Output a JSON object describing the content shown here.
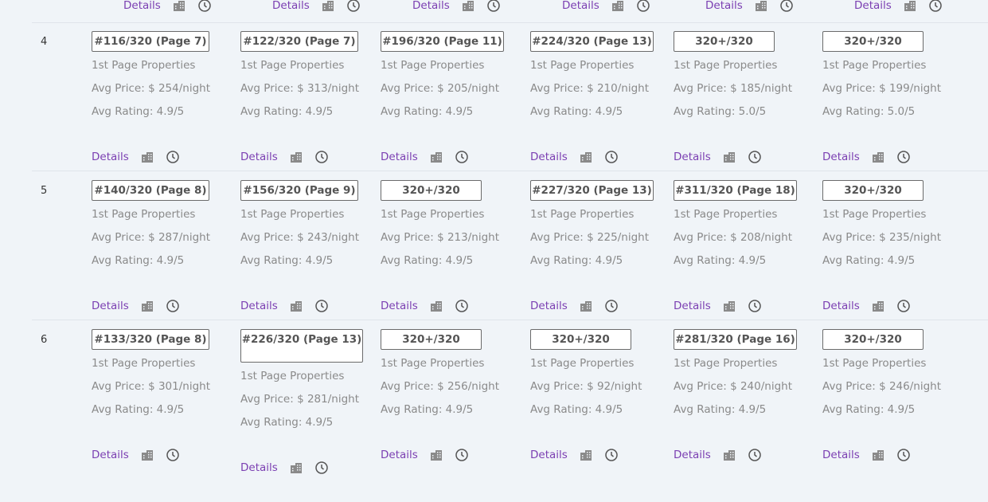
{
  "labels": {
    "details": "Details",
    "first_page": "1st Page Properties"
  },
  "colors": {
    "background": "#f0f4f8",
    "link": "#7b3fb2",
    "muted_text": "#8a8a8a",
    "icon": "#8a8a8a"
  },
  "icons": [
    "building-icon",
    "history-clock-icon"
  ],
  "rows": [
    {
      "rank": "4",
      "cells": [
        {
          "badge": "#116/320 (Page 7)",
          "price": "Avg Price: $ 254/night",
          "rating": "Avg Rating: 4.9/5"
        },
        {
          "badge": "#122/320 (Page 7)",
          "price": "Avg Price: $ 313/night",
          "rating": "Avg Rating: 4.9/5"
        },
        {
          "badge": "#196/320 (Page 11)",
          "price": "Avg Price: $ 205/night",
          "rating": "Avg Rating: 4.9/5"
        },
        {
          "badge": "#224/320 (Page 13)",
          "price": "Avg Price: $ 210/night",
          "rating": "Avg Rating: 4.9/5"
        },
        {
          "badge": "320+/320",
          "price": "Avg Price: $ 185/night",
          "rating": "Avg Rating: 5.0/5"
        },
        {
          "badge": "320+/320",
          "price": "Avg Price: $ 199/night",
          "rating": "Avg Rating: 5.0/5"
        }
      ]
    },
    {
      "rank": "5",
      "cells": [
        {
          "badge": "#140/320 (Page 8)",
          "price": "Avg Price: $ 287/night",
          "rating": "Avg Rating: 4.9/5"
        },
        {
          "badge": "#156/320 (Page 9)",
          "price": "Avg Price: $ 243/night",
          "rating": "Avg Rating: 4.9/5"
        },
        {
          "badge": "320+/320",
          "price": "Avg Price: $ 213/night",
          "rating": "Avg Rating: 4.9/5"
        },
        {
          "badge": "#227/320 (Page 13)",
          "price": "Avg Price: $ 225/night",
          "rating": "Avg Rating: 4.9/5"
        },
        {
          "badge": "#311/320 (Page 18)",
          "price": "Avg Price: $ 208/night",
          "rating": "Avg Rating: 4.9/5"
        },
        {
          "badge": "320+/320",
          "price": "Avg Price: $ 235/night",
          "rating": "Avg Rating: 4.9/5"
        }
      ]
    },
    {
      "rank": "6",
      "cells": [
        {
          "badge": "#133/320 (Page 8)",
          "price": "Avg Price: $ 301/night",
          "rating": "Avg Rating: 4.9/5"
        },
        {
          "badge": "#226/320 (Page 13)",
          "price": "Avg Price: $ 281/night",
          "rating": "Avg Rating: 4.9/5"
        },
        {
          "badge": "320+/320",
          "price": "Avg Price: $ 256/night",
          "rating": "Avg Rating: 4.9/5"
        },
        {
          "badge": "320+/320",
          "price": "Avg Price: $ 92/night",
          "rating": "Avg Rating: 4.9/5"
        },
        {
          "badge": "#281/320 (Page 16)",
          "price": "Avg Price: $ 240/night",
          "rating": "Avg Rating: 4.9/5"
        },
        {
          "badge": "320+/320",
          "price": "Avg Price: $ 246/night",
          "rating": "Avg Rating: 4.9/5"
        }
      ]
    }
  ]
}
